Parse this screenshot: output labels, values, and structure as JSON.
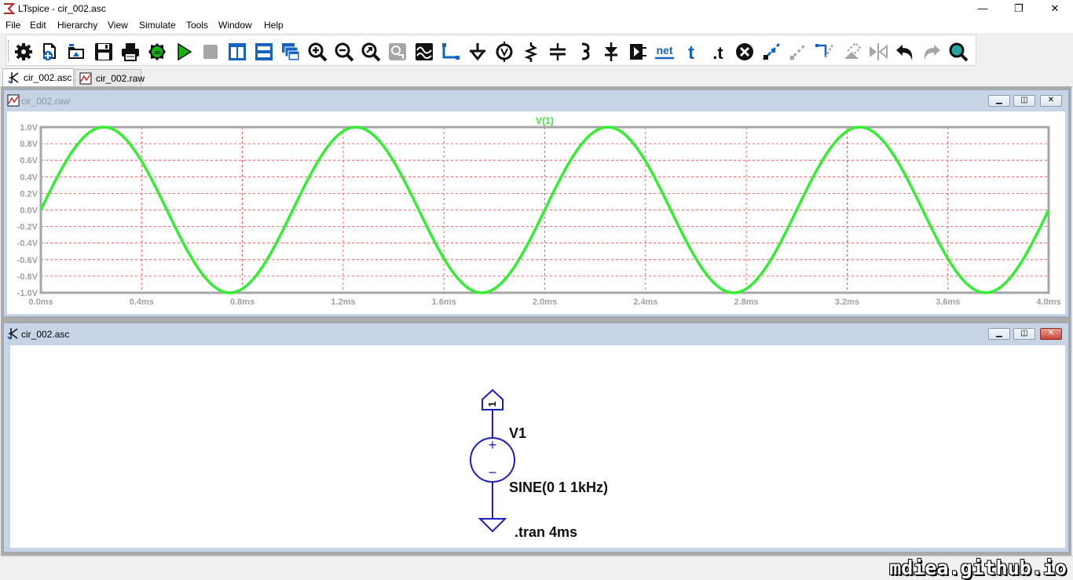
{
  "window": {
    "title": "LTspice - cir_002.asc",
    "minimize_glyph": "—",
    "maximize_glyph": "❐",
    "close_glyph": "✕"
  },
  "menu": [
    "File",
    "Edit",
    "Hierarchy",
    "View",
    "Simulate",
    "Tools",
    "Window",
    "Help"
  ],
  "toolbar": {
    "icons": [
      "control-panel",
      "new-schematic",
      "open",
      "save",
      "print",
      "netlist",
      "run",
      "halt",
      "tile-vertical",
      "tile-horizontal",
      "cascade",
      "zoom-in",
      "zoom-out",
      "zoom-fit",
      "zoom-back",
      "autorange",
      "wire",
      "ground",
      "label-net",
      "resistor",
      "capacitor",
      "inductor",
      "diode",
      "component",
      "net-label",
      "text",
      "spice-directive",
      "delete",
      "duplicate",
      "move",
      "drag",
      "rotate",
      "mirror",
      "undo",
      "redo",
      "find"
    ],
    "net_label": "net",
    "text_glyph": "t",
    "directive_glyph": ".t",
    "accent": "#0000ff"
  },
  "tabs": [
    {
      "label": "cir_002.asc",
      "active": true
    },
    {
      "label": "cir_002.raw",
      "active": false
    }
  ],
  "plot_window": {
    "title": "cir_002.raw",
    "trace_label": "V(1)",
    "trace_color": "#33ee33",
    "grid_color": "#dd4444"
  },
  "chart_data": {
    "type": "line",
    "title": "",
    "series": [
      {
        "name": "V(1)",
        "function": "sine",
        "amplitude": 1,
        "offset": 0,
        "frequency_hz": 1000
      }
    ],
    "x_range_ms": [
      0,
      4
    ],
    "ylim": [
      -1,
      1
    ],
    "x_ticks": [
      "0.0ms",
      "0.4ms",
      "0.8ms",
      "1.2ms",
      "1.6ms",
      "2.0ms",
      "2.4ms",
      "2.8ms",
      "3.2ms",
      "3.6ms",
      "4.0ms"
    ],
    "y_ticks": [
      "1.0V",
      "0.8V",
      "0.6V",
      "0.4V",
      "0.2V",
      "0.0V",
      "-0.2V",
      "-0.4V",
      "-0.6V",
      "-0.8V",
      "-1.0V"
    ],
    "grid": true
  },
  "schematic_window": {
    "title": "cir_002.asc",
    "node_label": "1",
    "component_name": "V1",
    "component_value": "SINE(0 1 1kHz)",
    "directive": ".tran 4ms",
    "plus": "+",
    "minus": "−"
  },
  "watermark": "mdiea.github.io"
}
